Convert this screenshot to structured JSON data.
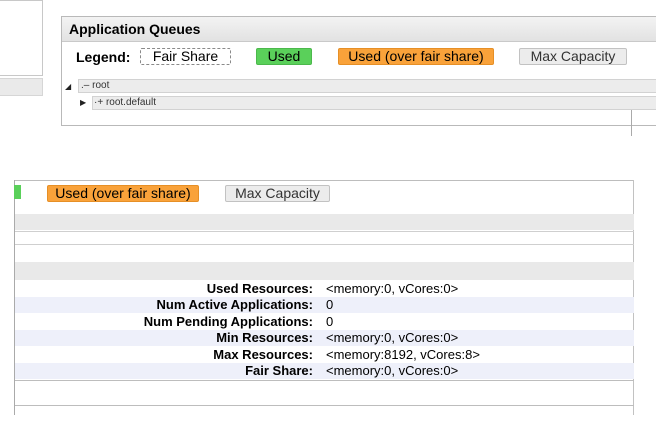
{
  "panel": {
    "title": "Application Queues"
  },
  "legend": {
    "label": "Legend:",
    "fair_share": "Fair Share",
    "used": "Used",
    "used_over": "Used (over fair share)",
    "max_capacity": "Max Capacity"
  },
  "tree": [
    {
      "label": ".– root"
    },
    {
      "label": "·+ root.default"
    }
  ],
  "bottom_legend": {
    "used_over": "Used (over fair share)",
    "max_capacity": "Max Capacity"
  },
  "queue_info": [
    {
      "key": "Used Resources:",
      "value": "<memory:0, vCores:0>"
    },
    {
      "key": "Num Active Applications:",
      "value": "0"
    },
    {
      "key": "Num Pending Applications:",
      "value": "0"
    },
    {
      "key": "Min Resources:",
      "value": "<memory:0, vCores:0>"
    },
    {
      "key": "Max Resources:",
      "value": "<memory:8192, vCores:8>"
    },
    {
      "key": "Fair Share:",
      "value": "<memory:0, vCores:0>"
    }
  ],
  "colors": {
    "used": "#5ad05a",
    "over": "#f9a23a",
    "max": "#ececec"
  }
}
